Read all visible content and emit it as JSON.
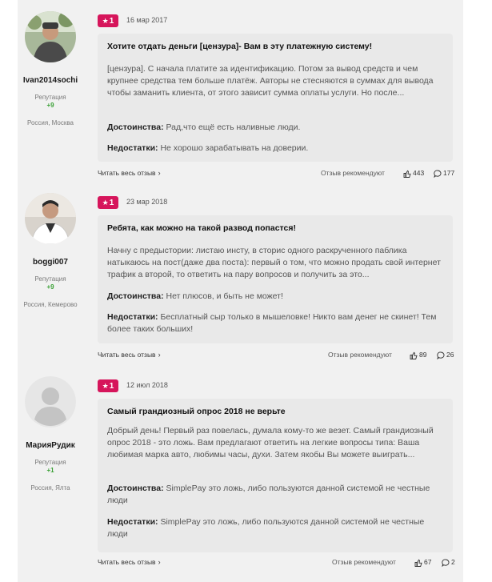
{
  "colors": {
    "badge": "#d6155b",
    "reputation": "#3aa035",
    "background": "#f1f1f1",
    "card": "#e9e9e9"
  },
  "reviews": [
    {
      "author": {
        "name": "Ivan2014sochi",
        "reputation_label": "Репутация",
        "reputation": "+9",
        "location": "Россия, Москва",
        "avatar_icon": "user-photo"
      },
      "rating": "1",
      "date": "16 мар 2017",
      "title": "Хотите отдать деньги [цензура]- Вам в эту платежную систему!",
      "text": "[цензура]. С начала платите за идентификацию. Потом за вывод средств и чем крупнее средства тем больше платёж. Авторы не стесняются в суммах для вывода чтобы заманить клиента, от этого зависит сумма оплаты услуги. Но после...",
      "pros_label": "Достоинства:",
      "pros": "Рад,что ещё есть наливные люди.",
      "cons_label": "Недостатки:",
      "cons": "Не хорошо зарабатывать на доверии.",
      "read_more": "Читать весь отзыв",
      "recommend": "Отзыв рекомендуют",
      "likes": "443",
      "comments": "177"
    },
    {
      "author": {
        "name": "boggi007",
        "reputation_label": "Репутация",
        "reputation": "+9",
        "location": "Россия, Кемерово",
        "avatar_icon": "user-photo"
      },
      "rating": "1",
      "date": "23 мар 2018",
      "title": "Ребята, как можно на такой развод попастся!",
      "text": "Начну с предыстории: листаю инсту, в сторис одного раскрученного паблика натыкаюсь на пост(даже два поста): первый о том, что можно продать свой интернет трафик а второй, то ответить на пару вопросов и получить за это...",
      "pros_label": "Достоинства:",
      "pros": "Нет плюсов, и быть не может!",
      "cons_label": "Недостатки:",
      "cons": "Бесплатный сыр только в мышеловке! Никто вам денег не скинет! Тем более таких больших!",
      "read_more": "Читать весь отзыв",
      "recommend": "Отзыв рекомендуют",
      "likes": "89",
      "comments": "26"
    },
    {
      "author": {
        "name": "МарияРудик",
        "reputation_label": "Репутация",
        "reputation": "+1",
        "location": "Россия, Ялта",
        "avatar_icon": "default-avatar"
      },
      "rating": "1",
      "date": "12 июл 2018",
      "title": "Самый грандиозный опрос 2018 не верьте",
      "text": "Добрый день! Первый раз повелась, думала кому-то же везет. Самый грандиозный опрос 2018 - это ложь. Вам предлагают ответить на легкие вопросы типа: Ваша любимая марка авто, любимы часы, духи. Затем якобы Вы можете выиграть...",
      "pros_label": "Достоинства:",
      "pros": "SimplePay это ложь, либо пользуются данной системой не честные люди",
      "cons_label": "Недостатки:",
      "cons": "SimplePay это ложь, либо пользуются данной системой не честные люди",
      "read_more": "Читать весь отзыв",
      "recommend": "Отзыв рекомендуют",
      "likes": "67",
      "comments": "2"
    }
  ]
}
